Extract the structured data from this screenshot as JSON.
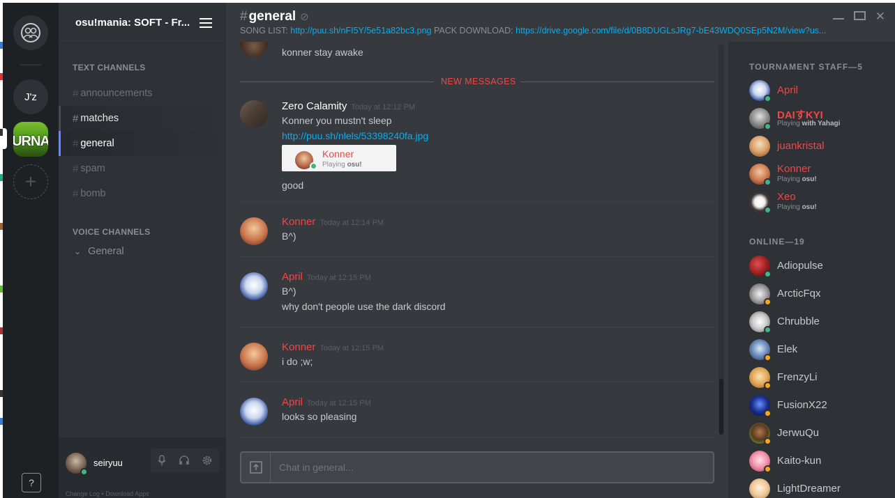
{
  "window": {
    "title": "osu!mania: SOFT - Fr..."
  },
  "servers": {
    "dm_label": "",
    "jz_label": "J'z",
    "tournament_label": "URNA",
    "add_label": "+",
    "help_label": "?"
  },
  "channels": {
    "text_category": "TEXT CHANNELS",
    "text": [
      {
        "name": "announcements"
      },
      {
        "name": "matches"
      },
      {
        "name": "general"
      },
      {
        "name": "spam"
      },
      {
        "name": "bomb"
      }
    ],
    "voice_category": "VOICE CHANNELS",
    "voice": [
      {
        "name": "General"
      }
    ]
  },
  "user": {
    "name": "seiryuu",
    "links": "Change Log  •  Download Apps"
  },
  "header": {
    "channel": "general",
    "topic_prefix": "SONG LIST: ",
    "song_link": "http://puu.sh/nFI5Y/5e51a82bc3.png",
    "topic_mid": " PACK DOWNLOAD: ",
    "pack_link": "https://drive.google.com/file/d/0B8DUGLsJRg7-bE43WDQ0SEp5N2M/view?us..."
  },
  "messages": {
    "top_line": "konner stay awake",
    "new_divider": "NEW MESSAGES",
    "list": [
      {
        "author": "Zero Calamity",
        "time": "Today at 12:12 PM",
        "line1": "Konner you mustn't sleep",
        "link": "http://puu.sh/nlels/53398240fa.jpg",
        "mention_name": "Konner",
        "mention_playing_pre": "Playing ",
        "mention_game": "osu!",
        "line_after": "good"
      },
      {
        "author": "Konner",
        "time": "Today at 12:14 PM",
        "line1": "B^)"
      },
      {
        "author": "April",
        "time": "Today at 12:15 PM",
        "line1": "B^)",
        "line2": "why don't people use the dark discord"
      },
      {
        "author": "Konner",
        "time": "Today at 12:15 PM",
        "line1": "i do ;w;"
      },
      {
        "author": "April",
        "time": "Today at 12:15 PM",
        "line1": "looks so pleasing"
      }
    ]
  },
  "composer": {
    "placeholder": "Chat in general..."
  },
  "members": {
    "staff_header": "TOURNAMENT STAFF—5",
    "staff": [
      {
        "name": "April"
      },
      {
        "name": "DAIすKYI",
        "game_pre": "Playing ",
        "game": "with Yahagi"
      },
      {
        "name": "juankristal"
      },
      {
        "name": "Konner",
        "game_pre": "Playing ",
        "game": "osu!"
      },
      {
        "name": "Xeo",
        "game_pre": "Playing ",
        "game": "osu!"
      }
    ],
    "online_header": "ONLINE—19",
    "online": [
      {
        "name": "Adiopulse"
      },
      {
        "name": "ArcticFqx"
      },
      {
        "name": "Chrubble"
      },
      {
        "name": "Elek"
      },
      {
        "name": "FrenzyLi"
      },
      {
        "name": "FusionX22"
      },
      {
        "name": "JerwuQu"
      },
      {
        "name": "Kaito-kun"
      },
      {
        "name": "LightDreamer"
      }
    ]
  },
  "colors": {
    "accent": "#7289da",
    "role_red": "#f04747",
    "online": "#43b581",
    "idle": "#faa61a",
    "link": "#00aff4"
  }
}
